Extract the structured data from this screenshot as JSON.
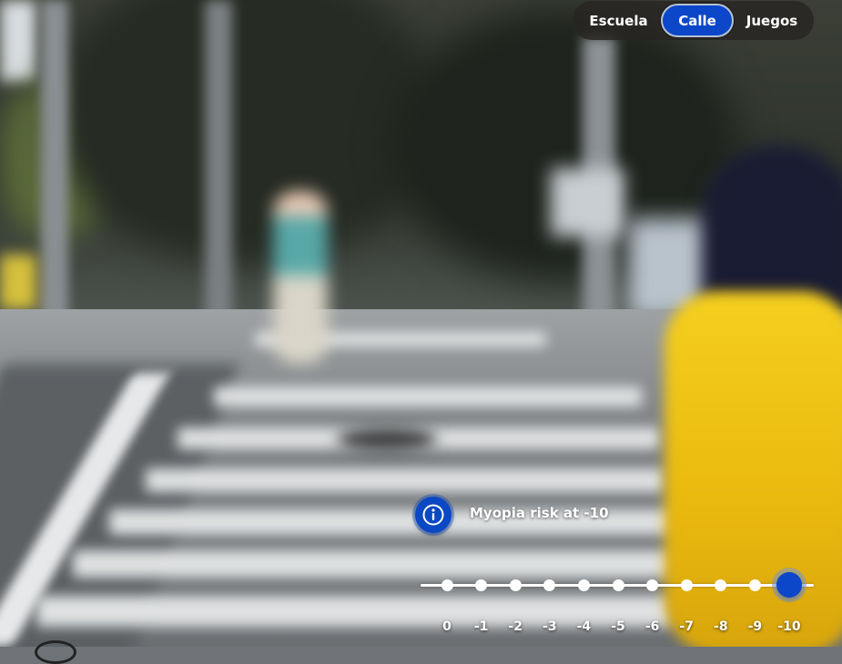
{
  "tabs": [
    {
      "label": "Escuela",
      "active": false
    },
    {
      "label": "Calle",
      "active": true
    },
    {
      "label": "Juegos",
      "active": false
    }
  ],
  "info": {
    "icon": "info-icon",
    "label": "Myopia risk at -10"
  },
  "slider": {
    "ticks": [
      "0",
      "-1",
      "-2",
      "-3",
      "-4",
      "-5",
      "-6",
      "-7",
      "-8",
      "-9",
      "-10"
    ],
    "selected": "-10"
  },
  "colors": {
    "accent": "#0c47c9",
    "tab_bar_bg": "#282422"
  }
}
